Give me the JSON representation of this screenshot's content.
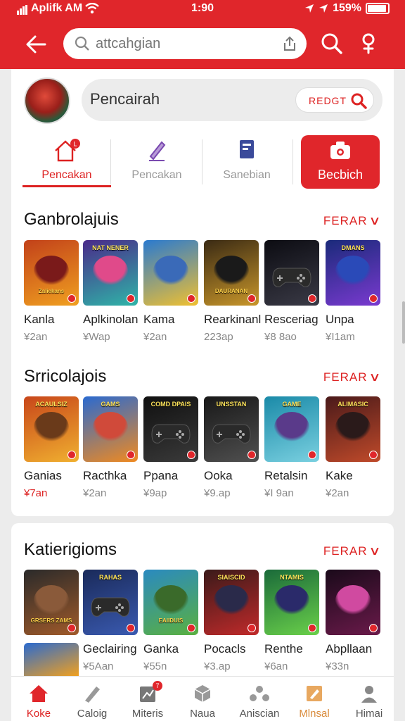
{
  "status": {
    "carrier": "Aplifk AM",
    "time": "1:90",
    "battery": "159%"
  },
  "search": {
    "placeholder": "attcahgian"
  },
  "profile": {
    "name": "Pencairah",
    "action_label": "REDGT"
  },
  "tabs": [
    {
      "label": "Pencakan",
      "icon": "home-icon"
    },
    {
      "label": "Pencakan",
      "icon": "pen-icon"
    },
    {
      "label": "Sanebian",
      "icon": "bookmark-icon"
    },
    {
      "label": "Becbich",
      "icon": "camera-icon"
    }
  ],
  "sections": [
    {
      "title": "Ganbrolajuis",
      "see_all": "FERAR",
      "games": [
        {
          "name": "Kanla",
          "size": "¥2an",
          "tile": {
            "title": "",
            "bottom": "Zaliekans",
            "c1": "#c2411a",
            "c2": "#f0a020",
            "art": "#7a1a1a"
          }
        },
        {
          "name": "Aplkinolan",
          "size": "¥Wap",
          "tile": {
            "title": "NAT NENER",
            "bottom": "",
            "c1": "#4a2a8a",
            "c2": "#2fb5a8",
            "art": "#e04a8a"
          }
        },
        {
          "name": "Kama",
          "size": "¥2an",
          "tile": {
            "title": "",
            "bottom": "",
            "c1": "#2a7ad0",
            "c2": "#f0c030",
            "art": "#3a6ab8"
          }
        },
        {
          "name": "Rearkinanl",
          "size": "223ap",
          "tile": {
            "title": "",
            "bottom": "DAURANAN",
            "c1": "#3a2a14",
            "c2": "#c8962a",
            "art": "#1a1a1a"
          }
        },
        {
          "name": "Resceriag",
          "size": "¥8 8ao",
          "tile": {
            "title": "",
            "bottom": "",
            "c1": "#0c0c12",
            "c2": "#3a3a46",
            "art": "#111111",
            "pad": true
          }
        },
        {
          "name": "Unpa",
          "size": "¥I1am",
          "tile": {
            "title": "DMANS",
            "bottom": "",
            "c1": "#1a2a7a",
            "c2": "#7a3ad0",
            "art": "#2a4ab8"
          }
        }
      ]
    },
    {
      "title": "Srricolajois",
      "see_all": "FERAR",
      "games": [
        {
          "name": "Ganias",
          "size": "¥7an",
          "size_red": true,
          "tile": {
            "title": "ACAULSIZ",
            "bottom": "",
            "c1": "#c8461a",
            "c2": "#f0b030",
            "art": "#6a3a1a"
          }
        },
        {
          "name": "Racthka",
          "size": "¥2an",
          "tile": {
            "title": "GAMS",
            "bottom": "",
            "c1": "#2a6ad0",
            "c2": "#f08a20",
            "art": "#d04a3a"
          }
        },
        {
          "name": "Ppana",
          "size": "¥9ap",
          "tile": {
            "title": "COMD DPAIS",
            "bottom": "",
            "c1": "#101010",
            "c2": "#3a3a3a",
            "art": "#111111",
            "pad": true
          }
        },
        {
          "name": "Ooka",
          "size": "¥9.ap",
          "tile": {
            "title": "UNSSTAN",
            "bottom": "",
            "c1": "#181818",
            "c2": "#505050",
            "art": "#111111",
            "pad": true
          }
        },
        {
          "name": "Retalsin",
          "size": "¥I 9an",
          "tile": {
            "title": "GAME",
            "bottom": "",
            "c1": "#1a8aa8",
            "c2": "#7ad0e0",
            "art": "#5a3a8a"
          }
        },
        {
          "name": "Kake",
          "size": "¥2an",
          "tile": {
            "title": "ALIMASIC",
            "bottom": "",
            "c1": "#4a1a1a",
            "c2": "#c04a2a",
            "art": "#2a1a1a"
          }
        }
      ]
    },
    {
      "title": "Katierigioms",
      "see_all": "FERAR",
      "games": [
        {
          "name": "",
          "size": "",
          "tile": {
            "title": "",
            "bottom": "GRSERS ZAMS",
            "c1": "#2a2a2a",
            "c2": "#a05a2a",
            "art": "#8a5a3a"
          }
        },
        {
          "name": "Geclairing",
          "size": "¥5Aan",
          "tile": {
            "title": "RAHAS",
            "bottom": "",
            "c1": "#1a2a5a",
            "c2": "#3a5ab0",
            "art": "#111111",
            "pad": true
          }
        },
        {
          "name": "Ganka",
          "size": "¥55n",
          "tile": {
            "title": "",
            "bottom": "EAIIDUIS",
            "c1": "#2a8ac0",
            "c2": "#5ab040",
            "art": "#3a6a2a"
          }
        },
        {
          "name": "Pocacls",
          "size": "¥3.ap",
          "tile": {
            "title": "SIAISCID",
            "bottom": "",
            "c1": "#3a1a1a",
            "c2": "#c02a2a",
            "art": "#2a2a4a"
          }
        },
        {
          "name": "Renthe",
          "size": "¥6an",
          "tile": {
            "title": "NTAMIS",
            "bottom": "",
            "c1": "#1a6a3a",
            "c2": "#6ad04a",
            "art": "#2a2a6a"
          }
        },
        {
          "name": "Abpllaan",
          "size": "¥33n",
          "tile": {
            "title": "",
            "bottom": "",
            "c1": "#1a0a1a",
            "c2": "#6a1a4a",
            "art": "#d04aa0"
          }
        }
      ]
    }
  ],
  "partial_tile": {
    "c1": "#2a6ad0",
    "c2": "#f0a020"
  },
  "bottom_nav": [
    {
      "label": "Koke",
      "icon": "home-icon",
      "active": true
    },
    {
      "label": "Caloig",
      "icon": "pen-icon"
    },
    {
      "label": "Miteris",
      "icon": "chart-icon",
      "badge": "7"
    },
    {
      "label": "Naua",
      "icon": "cube-icon"
    },
    {
      "label": "Aniscian",
      "icon": "people-icon"
    },
    {
      "label": "Mlnsal",
      "icon": "edit-icon",
      "orange": true
    },
    {
      "label": "Himai",
      "icon": "user-icon"
    }
  ],
  "colors": {
    "accent": "#e0262b",
    "background": "#ececec"
  }
}
